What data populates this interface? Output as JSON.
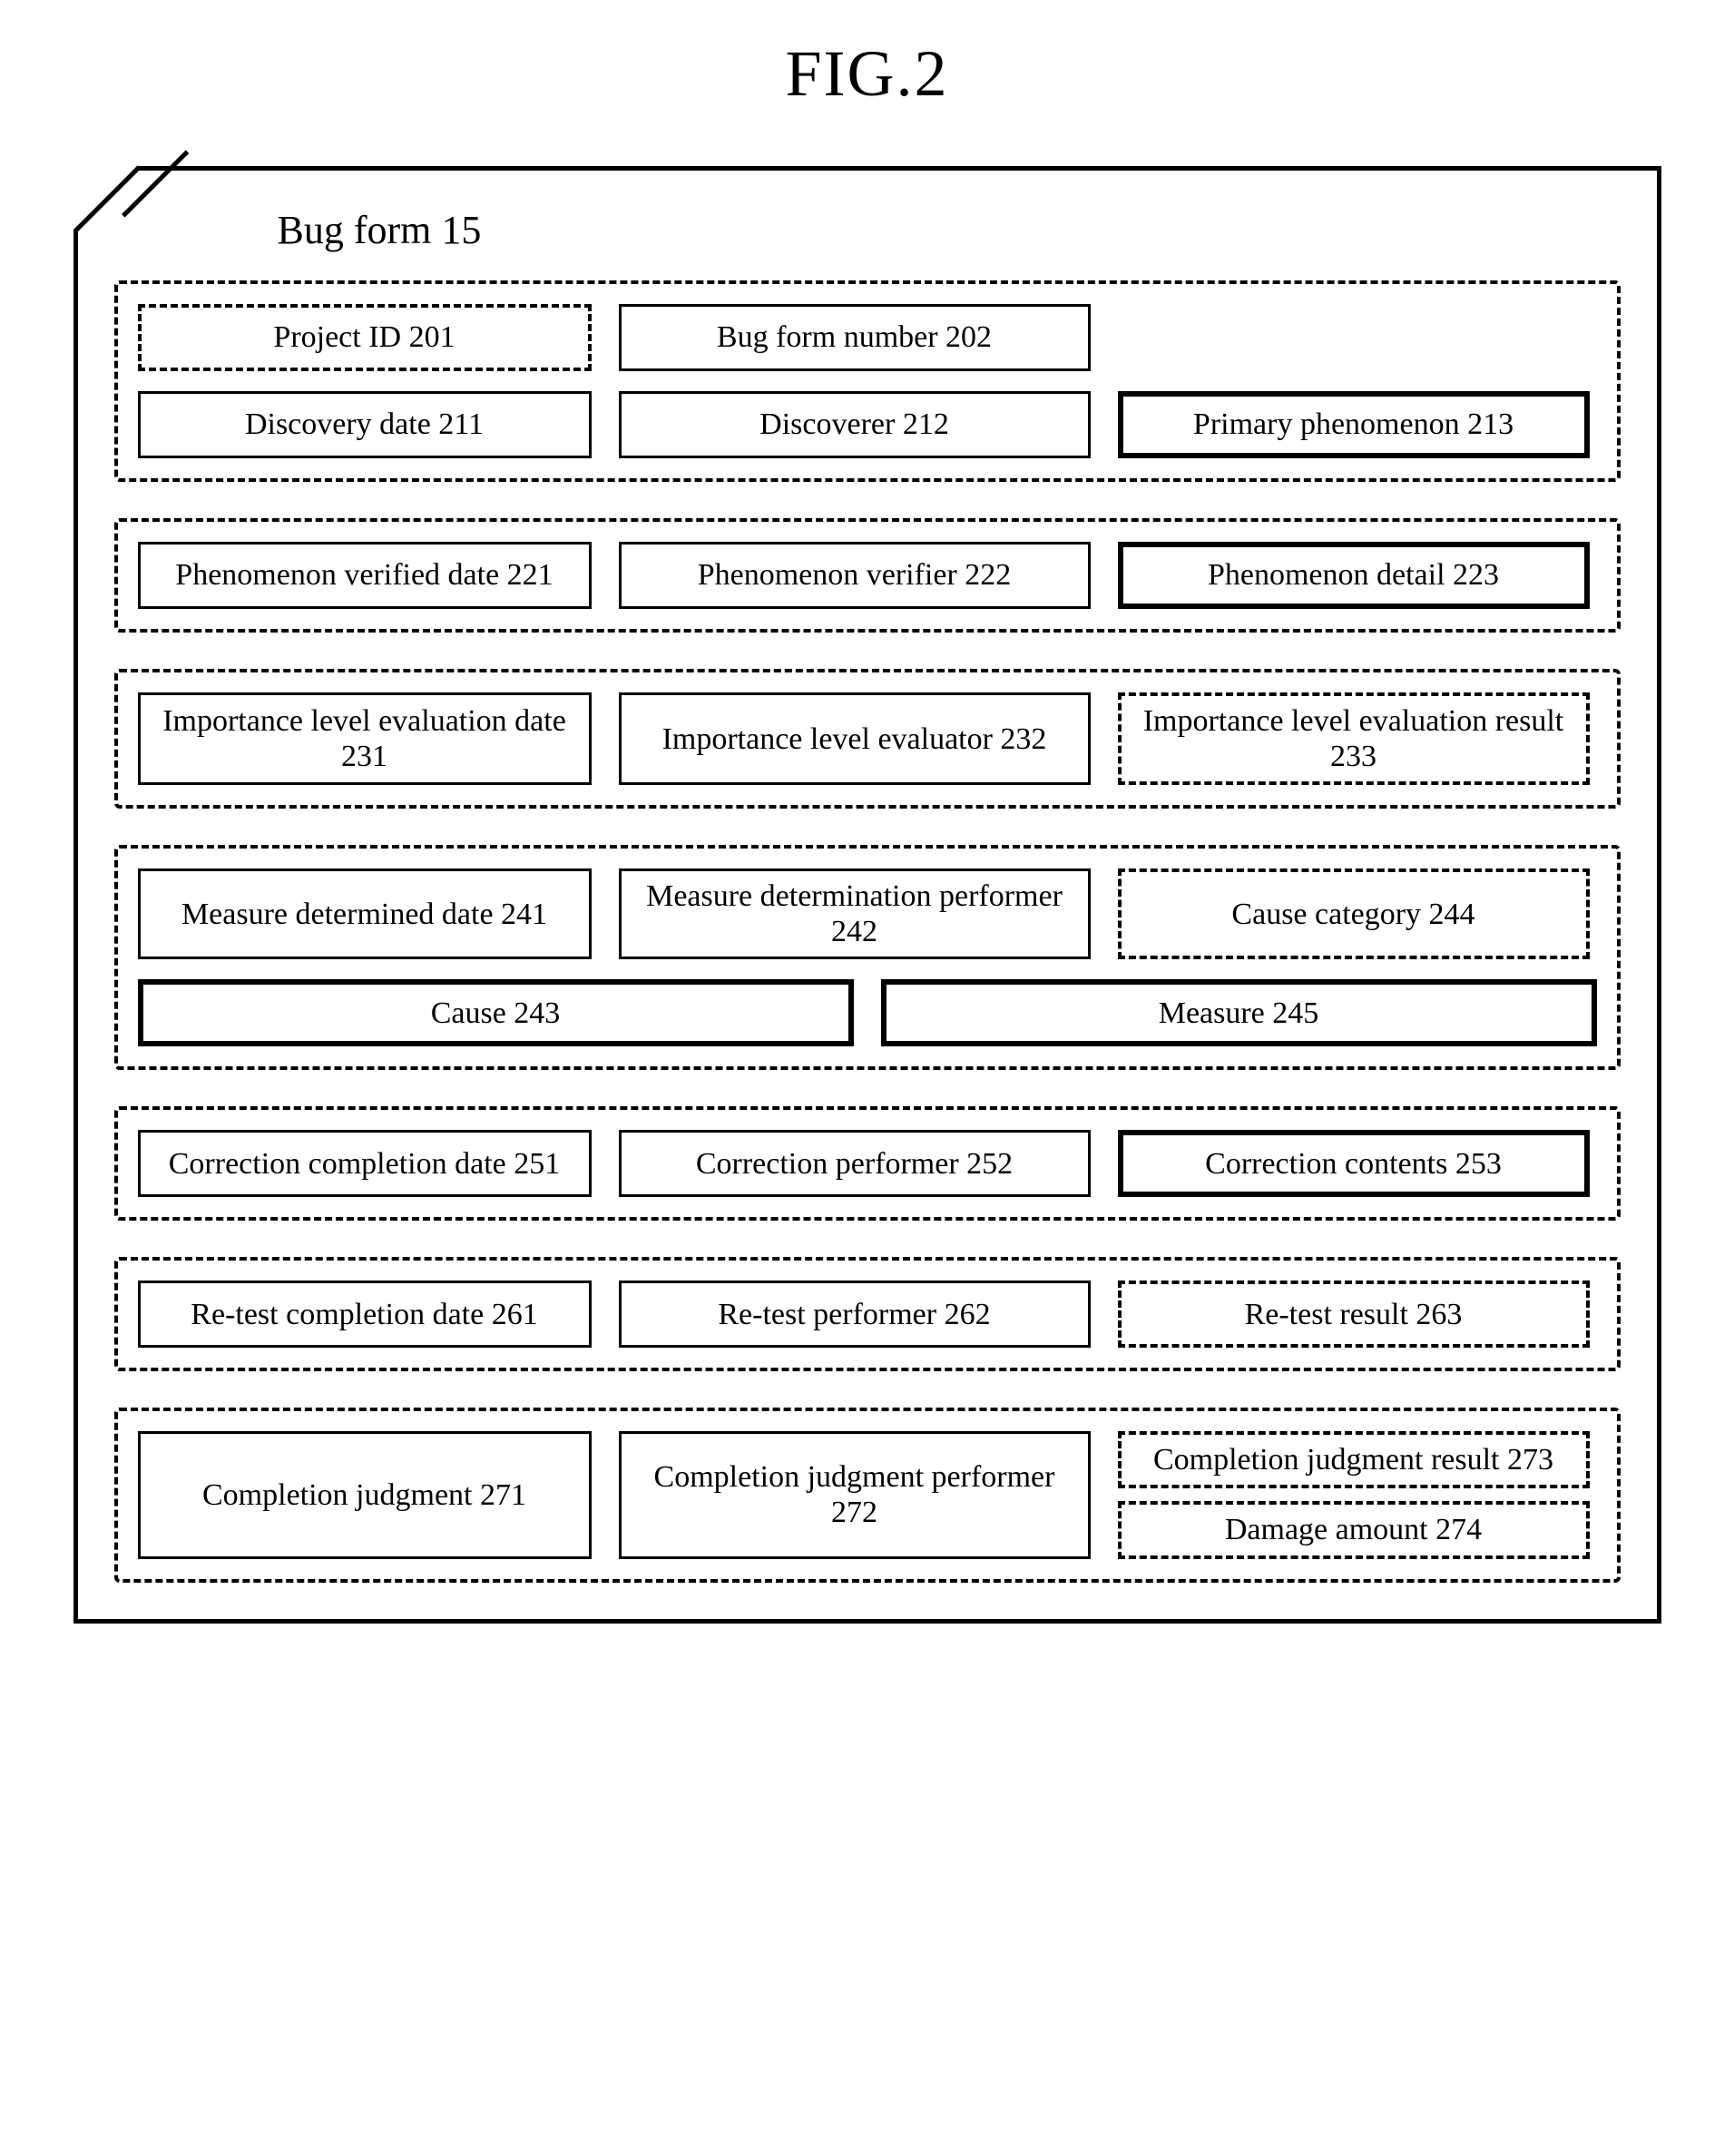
{
  "figure_title": "FIG.2",
  "doc_title": "Bug form 15",
  "g1": {
    "r1": {
      "a": "Project ID 201",
      "b": "Bug form number 202"
    },
    "r2": {
      "a": "Discovery date 211",
      "b": "Discoverer 212",
      "c": "Primary phenomenon 213"
    }
  },
  "g2": {
    "r1": {
      "a": "Phenomenon verified date 221",
      "b": "Phenomenon verifier 222",
      "c": "Phenomenon detail 223"
    }
  },
  "g3": {
    "r1": {
      "a": "Importance level evaluation date 231",
      "b": "Importance level evaluator 232",
      "c": "Importance level evaluation result 233"
    }
  },
  "g4": {
    "r1": {
      "a": "Measure determined date 241",
      "b": "Measure determination performer 242",
      "c": "Cause category 244"
    },
    "r2": {
      "a": "Cause 243",
      "b": "Measure 245"
    }
  },
  "g5": {
    "r1": {
      "a": "Correction completion date 251",
      "b": "Correction performer 252",
      "c": "Correction contents 253"
    }
  },
  "g6": {
    "r1": {
      "a": "Re-test completion date 261",
      "b": "Re-test performer 262",
      "c": "Re-test result 263"
    }
  },
  "g7": {
    "r1": {
      "a": "Completion judgment 271",
      "b": "Completion judgment performer 272",
      "c": "Completion judgment result 273",
      "d": "Damage amount 274"
    }
  }
}
